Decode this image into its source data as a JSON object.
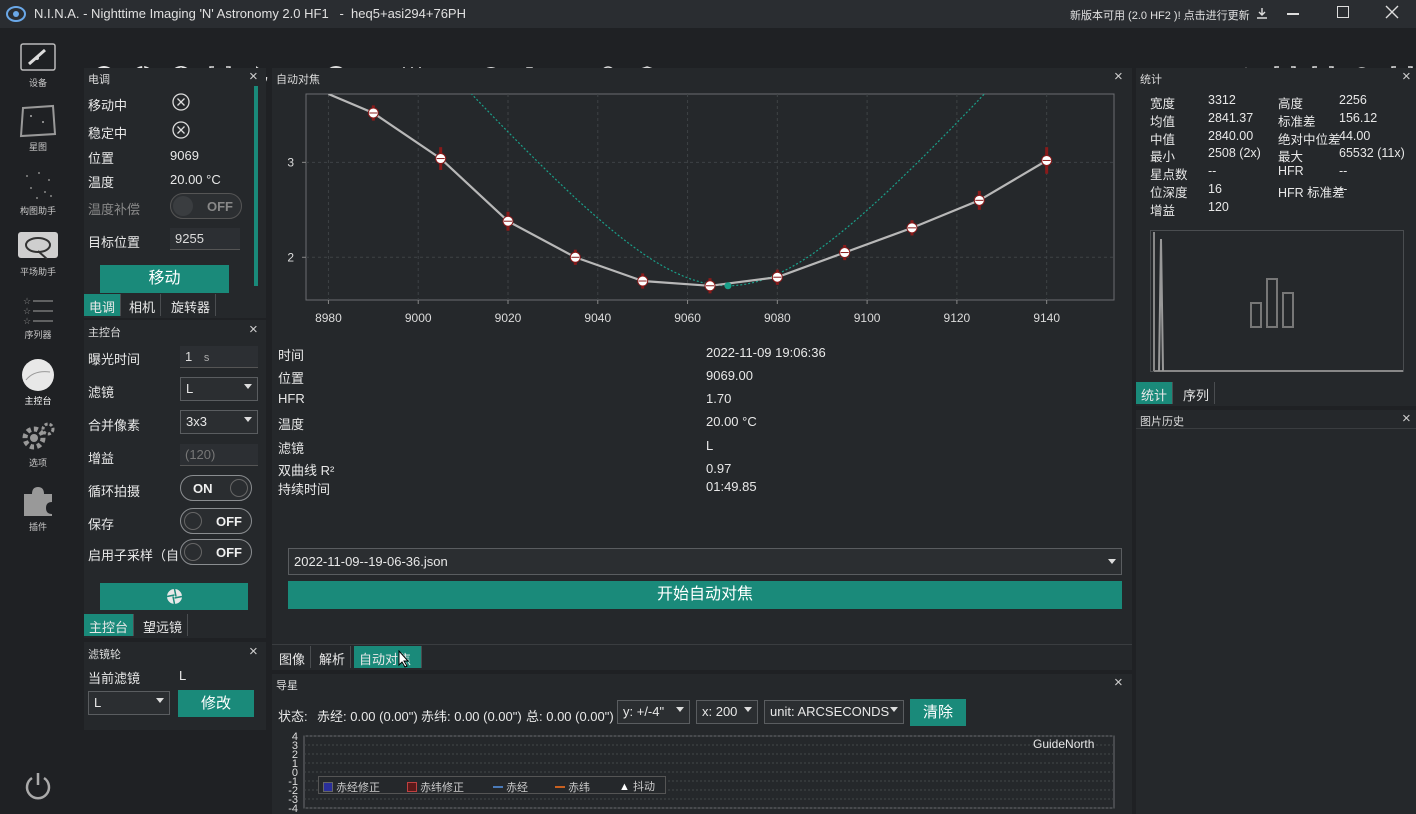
{
  "window": {
    "title": "N.I.N.A. - Nighttime Imaging 'N' Astronomy 2.0 HF1   -  heq5+asi294+76PH",
    "update_notice": "新版本可用 (2.0 HF2 )! 点击进行更新"
  },
  "toolbar": {
    "info_label": "信息",
    "tools_label": "工具"
  },
  "sidebar": {
    "items": [
      {
        "label": "设备",
        "icon": "telescope-icon"
      },
      {
        "label": "星图",
        "icon": "skymap-icon"
      },
      {
        "label": "构图助手",
        "icon": "framing-icon"
      },
      {
        "label": "平场助手",
        "icon": "flat-wizard-icon"
      },
      {
        "label": "序列器",
        "icon": "sequencer-icon"
      },
      {
        "label": "主控台",
        "icon": "imaging-icon"
      },
      {
        "label": "选项",
        "icon": "gear-icon"
      },
      {
        "label": "插件",
        "icon": "plugin-icon"
      }
    ]
  },
  "focuser": {
    "title": "电调",
    "rows": [
      {
        "label": "移动中",
        "value": ""
      },
      {
        "label": "稳定中",
        "value": ""
      },
      {
        "label": "位置",
        "value": "9069"
      },
      {
        "label": "温度",
        "value": "20.00 °C"
      },
      {
        "label": "温度补偿",
        "value": ""
      },
      {
        "label": "目标位置",
        "value": ""
      }
    ],
    "temp_comp_toggle": "OFF",
    "target_position": "9255",
    "move_button": "移动",
    "tabs": [
      "电调",
      "相机",
      "旋转器"
    ]
  },
  "imaging": {
    "title": "主控台",
    "exposure_label": "曝光时间",
    "exposure_value": "1",
    "exposure_unit": "s",
    "filter_label": "滤镜",
    "filter_value": "L",
    "binning_label": "合并像素",
    "binning_value": "3x3",
    "gain_label": "增益",
    "gain_value": "(120)",
    "loop_label": "循环拍摄",
    "loop_toggle": "ON",
    "save_label": "保存",
    "save_toggle": "OFF",
    "subsample_label": "启用子采样（自",
    "subsample_toggle": "OFF",
    "tabs": [
      "主控台",
      "望远镜"
    ]
  },
  "filterwheel": {
    "title": "滤镜轮",
    "current_label": "当前滤镜",
    "current_value": "L",
    "select_value": "L",
    "change_button": "修改"
  },
  "autofocus": {
    "title": "自动对焦",
    "info": [
      {
        "label": "时间",
        "value": "2022-11-09 19:06:36"
      },
      {
        "label": "位置",
        "value": "9069.00"
      },
      {
        "label": "HFR",
        "value": "1.70"
      },
      {
        "label": "温度",
        "value": "20.00 °C"
      },
      {
        "label": "滤镜",
        "value": "L"
      },
      {
        "label": "双曲线 R²",
        "value": "0.97"
      },
      {
        "label": "持续时间",
        "value": "01:49.85"
      }
    ],
    "file_select": "2022-11-09--19-06-36.json",
    "start_button": "开始自动对焦",
    "tabs": [
      "图像",
      "解析",
      "自动对焦"
    ]
  },
  "chart_data": {
    "type": "line",
    "xlim": [
      8975,
      9155
    ],
    "ylim": [
      1.55,
      3.72
    ],
    "xticks": [
      8980,
      9000,
      9020,
      9040,
      9060,
      9080,
      9100,
      9120,
      9140
    ],
    "yticks": [
      2,
      3
    ],
    "series": [
      {
        "x": [
          8990,
          9005,
          9020,
          9035,
          9050,
          9065,
          9080,
          9095,
          9110,
          9125,
          9140
        ],
        "y": [
          3.52,
          3.04,
          2.38,
          2.0,
          1.75,
          1.7,
          1.79,
          2.05,
          2.31,
          2.6,
          3.02
        ],
        "errors": [
          0.08,
          0.12,
          0.1,
          0.08,
          0.08,
          0.08,
          0.08,
          0.08,
          0.08,
          0.1,
          0.14
        ]
      }
    ],
    "fit_minimum": {
      "x": 9069,
      "y": 1.7
    },
    "grid": true
  },
  "stats": {
    "title": "统计",
    "rows": [
      {
        "l1": "宽度",
        "v1": "3312",
        "l2": "高度",
        "v2": "2256"
      },
      {
        "l1": "均值",
        "v1": "2841.37",
        "l2": "标准差",
        "v2": "156.12"
      },
      {
        "l1": "中值",
        "v1": "2840.00",
        "l2": "绝对中位差",
        "v2": "44.00"
      },
      {
        "l1": "最小",
        "v1": "2508 (2x)",
        "l2": "最大",
        "v2": "65532 (11x)"
      },
      {
        "l1": "星点数",
        "v1": "--",
        "l2": "HFR",
        "v2": "--"
      },
      {
        "l1": "位深度",
        "v1": "16",
        "l2": "HFR 标准差",
        "v2": "--"
      },
      {
        "l1": "增益",
        "v1": "120",
        "l2": "",
        "v2": ""
      }
    ],
    "tabs": [
      "统计",
      "序列"
    ]
  },
  "image_history": {
    "title": "图片历史"
  },
  "guider": {
    "title": "导星",
    "status_label": "状态:",
    "ra_text": "赤经: 0.00 (0.00\")",
    "dec_text": "赤纬: 0.00 (0.00\")",
    "total_text": "总: 0.00 (0.00\")",
    "y_select": "y: +/-4\"",
    "x_select": "x: 200",
    "unit_select": "unit: ARCSECONDS",
    "clear_button": "清除",
    "chart_label": "GuideNorth",
    "y_ticks": [
      "4",
      "3",
      "2",
      "1",
      "0",
      "-1",
      "-2",
      "-3",
      "-4"
    ],
    "legend": [
      {
        "label": "赤经修正",
        "color": "#2a2f9a"
      },
      {
        "label": "赤纬修正",
        "color": "#8a2020"
      },
      {
        "label": "赤经",
        "color": "#4a7ab8"
      },
      {
        "label": "赤纬",
        "color": "#c86020"
      },
      {
        "label": "抖动",
        "color": "#ffffff"
      }
    ]
  },
  "colors": {
    "accent": "#1a8a7a",
    "background": "#1f2124",
    "panel": "#25282b"
  }
}
